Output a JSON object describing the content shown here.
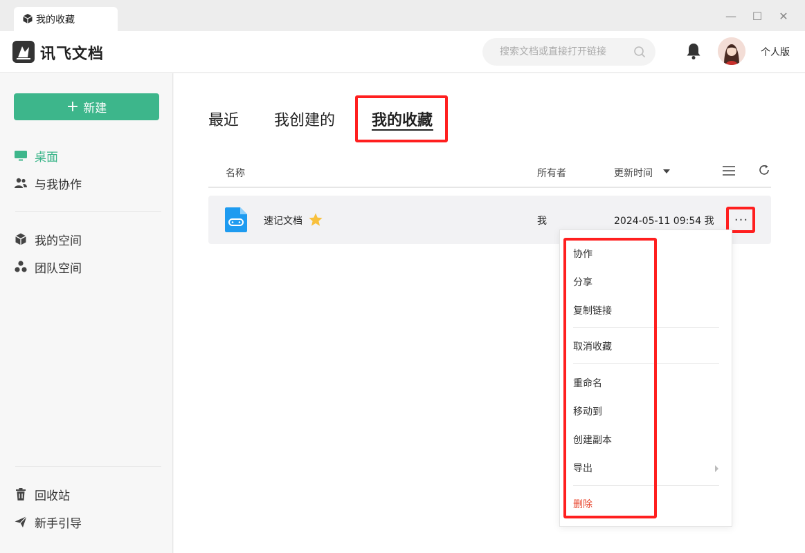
{
  "window": {
    "tab_title": "我的收藏",
    "minimize": "—",
    "maximize": "☐",
    "close": "✕"
  },
  "header": {
    "app_name": "讯飞文档",
    "search_placeholder": "搜索文档或直接打开链接",
    "edition": "个人版"
  },
  "sidebar": {
    "new_button": "新建",
    "items": [
      {
        "label": "桌面",
        "icon": "desktop-icon",
        "active": true
      },
      {
        "label": "与我协作",
        "icon": "people-icon"
      },
      {
        "label": "我的空间",
        "icon": "cube-icon"
      },
      {
        "label": "团队空间",
        "icon": "team-icon"
      }
    ],
    "bottom_items": [
      {
        "label": "回收站",
        "icon": "trash-icon"
      },
      {
        "label": "新手引导",
        "icon": "paper-plane-icon"
      }
    ]
  },
  "main": {
    "tabs": [
      {
        "label": "最近"
      },
      {
        "label": "我创建的"
      },
      {
        "label": "我的收藏",
        "active": true
      }
    ],
    "columns": {
      "name": "名称",
      "owner": "所有者",
      "updated": "更新时间"
    },
    "rows": [
      {
        "name": "速记文档",
        "owner": "我",
        "updated": "2024-05-11 09:54 我",
        "starred": true
      }
    ],
    "more": "···"
  },
  "context_menu": {
    "items": [
      "协作",
      "分享",
      "复制链接",
      "取消收藏",
      "重命名",
      "移动到",
      "创建副本",
      "导出",
      "删除"
    ]
  },
  "colors": {
    "accent": "#3db68b",
    "highlight": "#ff1f1f",
    "danger": "#e8472f"
  }
}
